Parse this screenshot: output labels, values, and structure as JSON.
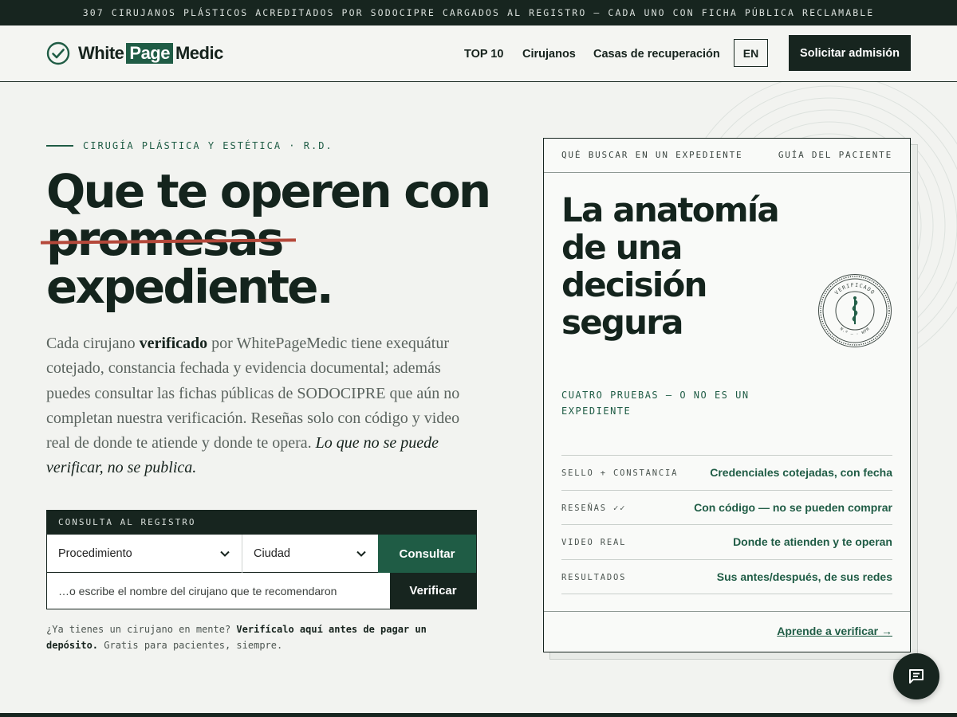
{
  "banner": {
    "text": "307 CIRUJANOS PLÁSTICOS ACREDITADOS POR SODOCIPRE CARGADOS AL REGISTRO — CADA UNO CON FICHA PÚBLICA RECLAMABLE"
  },
  "header": {
    "logo": {
      "part1": "White",
      "part2": "Page",
      "part3": "Medic"
    },
    "nav": [
      "TOP 10",
      "Cirujanos",
      "Casas de recuperación"
    ],
    "lang": "EN",
    "cta": "Solicitar admisión"
  },
  "hero": {
    "eyebrow": "CIRUGÍA PLÁSTICA Y ESTÉTICA · R.D.",
    "headline_line1": "Que te operen con",
    "headline_struck": "promesas",
    "headline_line3": "expediente.",
    "lead": {
      "p1": "Cada cirujano ",
      "bold": "verificado",
      "p2": " por WhitePageMedic tiene exequátur cotejado, constancia fechada y evidencia documental; además puedes consultar las fichas públicas de SODOCIPRE que aún no completan nuestra verificación. Reseñas solo con código y video real de donde te atiende y donde te opera. ",
      "italic": "Lo que no se puede verificar, no se publica."
    }
  },
  "search": {
    "header": "CONSULTA AL REGISTRO",
    "procedure": "Procedimiento",
    "city": "Ciudad",
    "consult_btn": "Consultar",
    "name_placeholder": "…o escribe el nombre del cirujano que te recomendaron",
    "verify_btn": "Verificar",
    "hint_1": "¿Ya tienes un cirujano en mente? ",
    "hint_bold": "Verifícalo aquí antes de pagar un depósito.",
    "hint_2": " Gratis para pacientes, siempre."
  },
  "card": {
    "top_left": "QUÉ BUSCAR EN UN EXPEDIENTE",
    "top_right": "GUÍA DEL PACIENTE",
    "title": "La anatomía de una decisión segura",
    "subtitle": "CUATRO PRUEBAS — O NO ES UN EXPEDIENTE",
    "seal_text": "VERIFICADO",
    "seal_bottom": "N.º — · WPM",
    "rows": [
      {
        "key": "SELLO + CONSTANCIA",
        "value": "Credenciales cotejadas, con fecha"
      },
      {
        "key": "RESEÑAS ✓✓",
        "value": "Con código — no se pueden comprar"
      },
      {
        "key": "VIDEO REAL",
        "value": "Donde te atienden y te operan"
      },
      {
        "key": "RESULTADOS",
        "value": "Sus antes/después, de sus redes"
      }
    ],
    "link": "Aprende a verificar →"
  },
  "colors": {
    "brand_green": "#1f5c45",
    "dark": "#17251f",
    "strike_red": "#b5483a",
    "background": "#f2f3f0"
  },
  "icons": {
    "logo": "check-circle-icon",
    "select_arrow": "chevron-down-icon",
    "seal": "caduceus-seal-icon",
    "chat": "chat-message-icon"
  }
}
